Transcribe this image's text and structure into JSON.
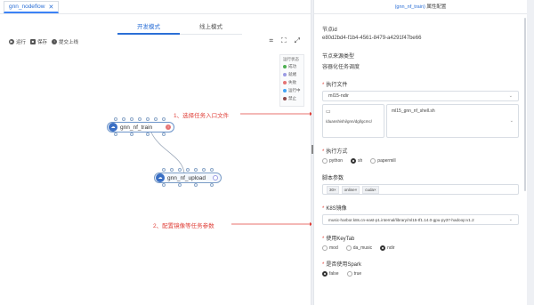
{
  "tab": {
    "title": "gnn_nodeflow",
    "close": "✕"
  },
  "modes": [
    "开发模式",
    "线上模式"
  ],
  "toolbar": {
    "run": "运行",
    "save": "保存",
    "submit": "提交上线"
  },
  "legend": {
    "title": "运行状态",
    "items": [
      {
        "label": "成功",
        "color": "#4caf50"
      },
      {
        "label": "就绪",
        "color": "#9b9be3"
      },
      {
        "label": "失败",
        "color": "#e57373"
      },
      {
        "label": "运行中",
        "color": "#42a5f5"
      },
      {
        "label": "禁止",
        "color": "#8d4a4a"
      }
    ]
  },
  "nodes": {
    "n1": "gnn_nf_train",
    "n2": "gnn_nf_upload"
  },
  "annotations": {
    "a1": "1、选择任务入口文件",
    "a2": "2、配置镜像等任务参数"
  },
  "panel": {
    "header_name": "(gnn_nf_train)",
    "header_suffix": "属性配置",
    "node_id_label": "节点id",
    "node_id": "e80d2bd4-f1b4-4561-8479-a4291f47be66",
    "source_type_label": "节点来源类型",
    "source_type": "容器化任务调度",
    "exec_file_label": "执行文件",
    "exec_file_select": "ml15-ndir",
    "file_icon": "▭",
    "file_path": "/duanshishi/gnn/dgl/gcmc/",
    "file_name": "ml15_gnn_nf_shell.sh",
    "exec_mode_label": "执行方式",
    "exec_modes": [
      {
        "label": "python",
        "on": false
      },
      {
        "label": "sh",
        "on": true
      },
      {
        "label": "papermill",
        "on": false
      }
    ],
    "script_params_label": "脚本参数",
    "script_params": [
      "30×",
      "online×",
      "cuda×"
    ],
    "k8s_label": "K8S镜像",
    "k8s_image": "music-harbor.k8s.cn-east-p1.internal/library/ml15-tf1.14.0-gpu-py37-hadoop:v1.2",
    "keytab_label": "使用KeyTab",
    "keytab_opts": [
      {
        "label": "mod",
        "on": false
      },
      {
        "label": "da_music",
        "on": false
      },
      {
        "label": "ndir",
        "on": true
      }
    ],
    "spark_label": "是否使用Spark",
    "spark_opts": [
      {
        "label": "false",
        "on": true
      },
      {
        "label": "true",
        "on": false
      }
    ],
    "required_mark": "*"
  }
}
